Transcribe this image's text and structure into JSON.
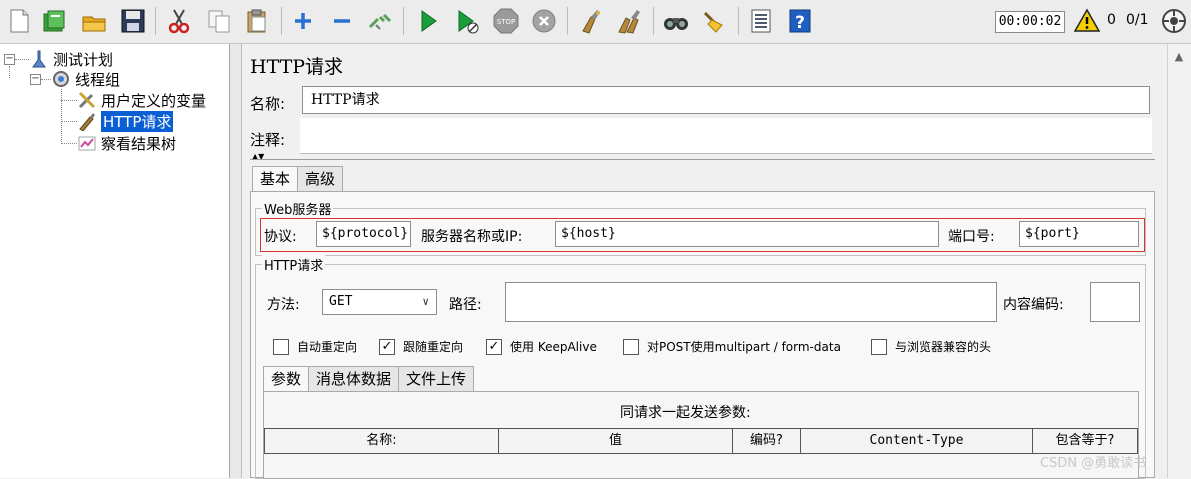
{
  "toolbar": {
    "icons": [
      "new-icon",
      "templates-icon",
      "open-icon",
      "save-icon",
      "cut-icon",
      "copy-icon",
      "paste-icon",
      "expand-icon",
      "collapse-icon",
      "toggle-icon",
      "start-icon",
      "start-no-pause-icon",
      "stop-icon",
      "shutdown-icon",
      "clear-icon",
      "clear-all-icon",
      "search-icon",
      "reset-search-icon",
      "function-helper-icon",
      "help-icon"
    ],
    "timer": "00:00:02",
    "warning_count": "0",
    "thread_count": "0/1",
    "colors": {
      "start": "#1a9e3a",
      "stop": "#9a9a9a",
      "help": "#1e5fbf"
    }
  },
  "tree": {
    "nodes": [
      {
        "label": "测试计划",
        "icon": "test-plan-icon"
      },
      {
        "label": "线程组",
        "icon": "thread-group-icon"
      },
      {
        "label": "用户定义的变量",
        "icon": "user-variables-icon"
      },
      {
        "label": "HTTP请求",
        "icon": "http-sampler-icon",
        "selected": true
      },
      {
        "label": "察看结果树",
        "icon": "result-tree-icon"
      }
    ]
  },
  "sampler": {
    "title": "HTTP请求",
    "name_label": "名称:",
    "name_value": "HTTP请求",
    "comment_label": "注释:",
    "tabs": [
      "基本",
      "高级"
    ],
    "web_server": {
      "title": "Web服务器",
      "protocol_label": "协议:",
      "protocol_value": "${protocol}",
      "server_label": "服务器名称或IP:",
      "server_value": "${host}",
      "port_label": "端口号:",
      "port_value": "${port}"
    },
    "http_request": {
      "title": "HTTP请求",
      "method_label": "方法:",
      "method_value": "GET",
      "path_label": "路径:",
      "encoding_label": "内容编码:",
      "checkboxes": [
        {
          "label": "自动重定向",
          "checked": false
        },
        {
          "label": "跟随重定向",
          "checked": true
        },
        {
          "label": "使用 KeepAlive",
          "checked": true
        },
        {
          "label": "对POST使用multipart / form-data",
          "checked": false
        },
        {
          "label": "与浏览器兼容的头",
          "checked": false
        }
      ]
    },
    "param_tabs": [
      "参数",
      "消息体数据",
      "文件上传"
    ],
    "params_caption": "同请求一起发送参数:",
    "param_columns": [
      "名称:",
      "值",
      "编码?",
      "Content-Type",
      "包含等于?"
    ]
  },
  "watermark": "CSDN @勇敢读书"
}
